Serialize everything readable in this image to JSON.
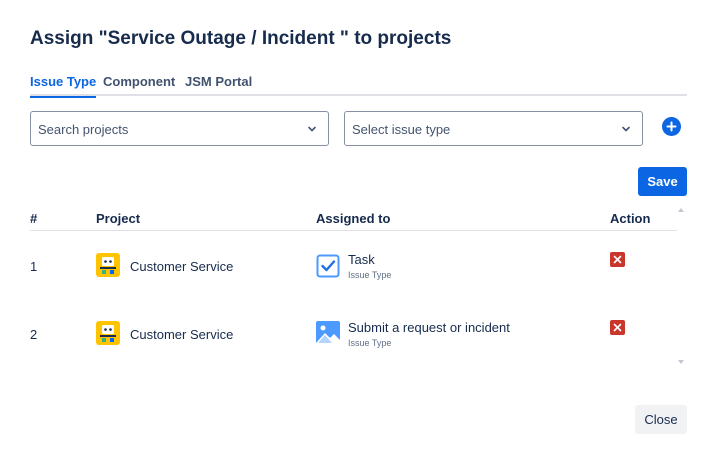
{
  "dialog": {
    "title": "Assign \"Service Outage / Incident \" to projects"
  },
  "tabs": [
    {
      "label": "Issue Type",
      "active": true
    },
    {
      "label": "Component",
      "active": false
    },
    {
      "label": "JSM Portal",
      "active": false
    }
  ],
  "filters": {
    "project_placeholder": "Search projects",
    "issue_type_placeholder": "Select issue type"
  },
  "actions": {
    "save_label": "Save",
    "close_label": "Close"
  },
  "table": {
    "headers": [
      "#",
      "Project",
      "Assigned to",
      "Action"
    ],
    "rows": [
      {
        "num": "1",
        "project": "Customer Service",
        "assigned": "Task",
        "assigned_sub": "Issue Type"
      },
      {
        "num": "2",
        "project": "Customer Service",
        "assigned": "Submit a request or incident",
        "assigned_sub": "Issue Type"
      }
    ]
  },
  "colors": {
    "primary": "#0c66e4",
    "danger": "#c9372c",
    "project_icon": "#ffc400"
  },
  "icons": {
    "add": "plus-circle-icon",
    "dropdown": "chevron-down-icon",
    "project": "project-avatar-icon",
    "task": "task-checkbox-icon",
    "request": "request-landscape-icon",
    "delete": "delete-x-icon"
  }
}
